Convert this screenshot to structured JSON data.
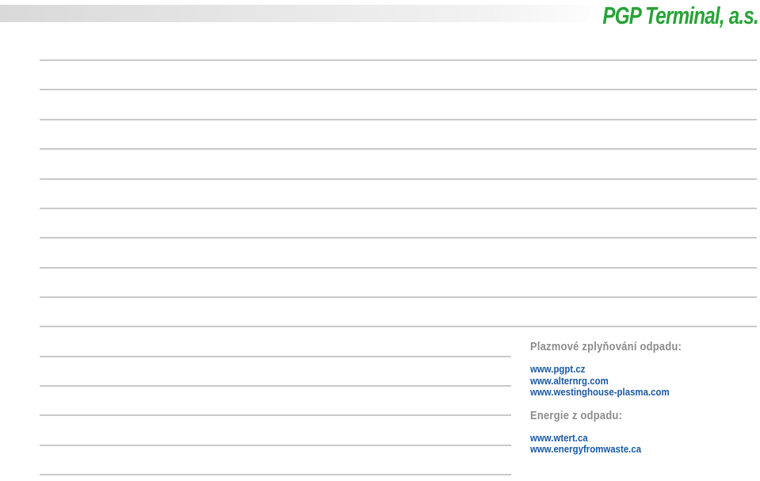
{
  "header": {
    "logo_text": "PGP Terminal, a.s.",
    "logo_color": "#26a336"
  },
  "section_plasma": {
    "heading": "Plazmové zplyňování odpadu:",
    "links": [
      "www.pgpt.cz",
      "www.alternrg.com",
      "www.westinghouse-plasma.com"
    ]
  },
  "section_energy": {
    "heading": "Energie z odpadu:",
    "links": [
      "www.wtert.ca",
      "www.energyfromwaste.ca"
    ]
  },
  "colors": {
    "heading_gray": "#8c8c8c",
    "link_blue": "#1a5aa6",
    "rule_gray": "#c9c9c9"
  }
}
